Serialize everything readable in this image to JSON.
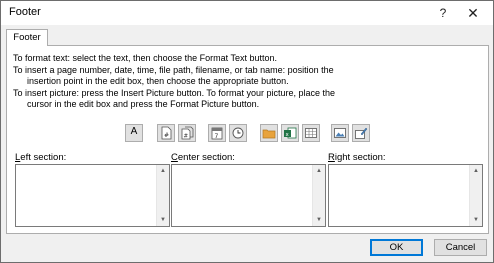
{
  "window": {
    "title": "Footer",
    "help": "?",
    "close": "✕"
  },
  "tab": {
    "label": "Footer"
  },
  "instructions": [
    {
      "text": "To format text:  select the text, then choose the Format Text button.",
      "indent": false
    },
    {
      "text": "To insert a page number, date, time, file path, filename, or tab name:  position the",
      "indent": false
    },
    {
      "text": "insertion point in the edit box, then choose the appropriate button.",
      "indent": true
    },
    {
      "text": "To insert picture: press the Insert Picture button.  To format your picture, place the",
      "indent": false
    },
    {
      "text": "cursor in the edit box and press the Format Picture button.",
      "indent": true
    }
  ],
  "toolbar": [
    {
      "icon": "format-text-icon",
      "glyph": "A"
    },
    {
      "icon": "insert-page-number-icon"
    },
    {
      "icon": "insert-number-of-pages-icon"
    },
    {
      "icon": "insert-date-icon"
    },
    {
      "icon": "insert-time-icon"
    },
    {
      "icon": "insert-file-path-icon"
    },
    {
      "icon": "insert-file-name-icon"
    },
    {
      "icon": "insert-sheet-name-icon"
    },
    {
      "icon": "insert-picture-icon"
    },
    {
      "icon": "format-picture-icon"
    }
  ],
  "sections": {
    "left": {
      "accel": "L",
      "rest": "eft section:"
    },
    "center": {
      "accel": "C",
      "rest": "enter section:"
    },
    "right": {
      "accel": "R",
      "rest": "ight section:"
    }
  },
  "buttons": {
    "ok": "OK",
    "cancel": "Cancel"
  },
  "colors": {
    "accent": "#0078d7",
    "folder": "#e8a33c",
    "excel": "#217346"
  }
}
